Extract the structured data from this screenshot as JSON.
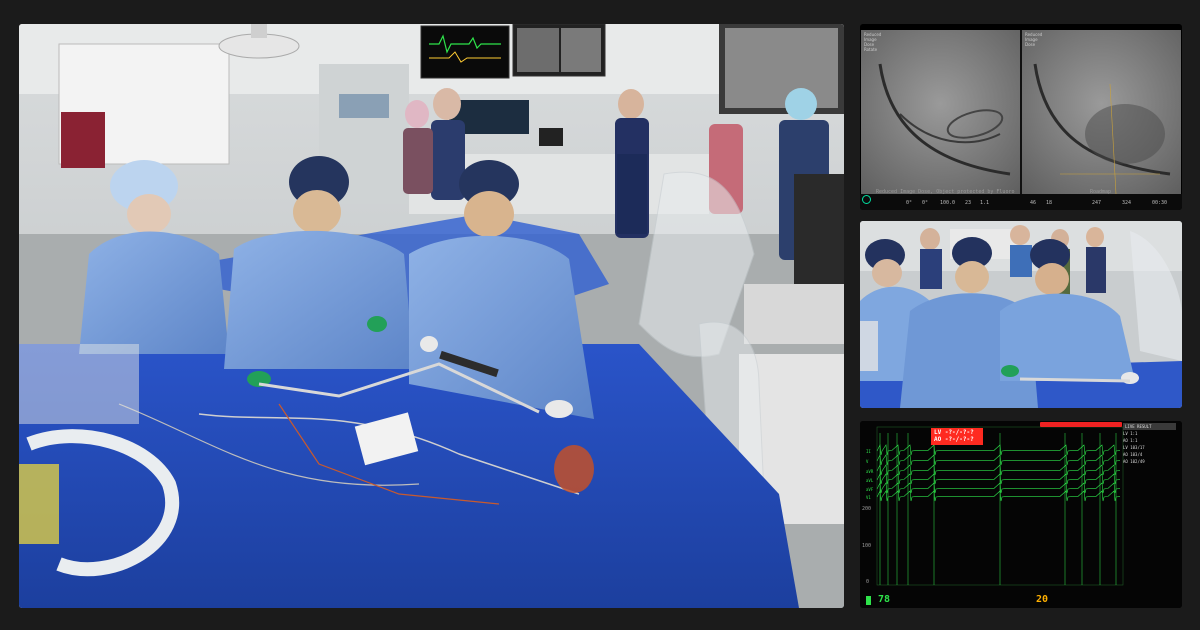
{
  "fluoro": {
    "overlay_left": [
      "Reduced",
      "Image",
      "Dose",
      "Rotate"
    ],
    "overlay_right": [
      "Reduced",
      "Image",
      "Dose"
    ],
    "footer": [
      {
        "label": "",
        "value": "0°"
      },
      {
        "label": "",
        "value": "0°"
      },
      {
        "label": "",
        "value": "100.0"
      },
      {
        "label": "",
        "value": "23"
      },
      {
        "label": "",
        "value": "1.1"
      },
      {
        "label": "",
        "value": "46"
      },
      {
        "label": "",
        "value": "18"
      },
      {
        "label": "",
        "value": "247"
      },
      {
        "label": "",
        "value": "324"
      },
      {
        "label": "",
        "value": "00:30"
      }
    ],
    "status_text": "Reduced Image Dose, Object protected by Fluoro",
    "mode_text": "Roadmap",
    "colors": {
      "accent": "#00e0a0",
      "bar": "#111111"
    }
  },
  "hemodynamics": {
    "pressure_lines": [
      "LV -?-/-?-?",
      "AO -?-/-?-?"
    ],
    "status_banner": "",
    "scale_labels": [
      "200",
      "100",
      "0"
    ],
    "channel_labels": [
      "II",
      "V",
      "aVR",
      "aVL",
      "aVF",
      "V1"
    ],
    "side_header": "LIVE RESULT",
    "side_rows": [
      "LV 1:1",
      "AO 1:1",
      "LV 103/17",
      "AO 103/4",
      "AO 102/49"
    ],
    "footer_left_value": "78",
    "footer_right_value": "20",
    "colors": {
      "trace": "#2ee34a",
      "alert": "#ff2a20",
      "value": "#ffb000"
    }
  }
}
